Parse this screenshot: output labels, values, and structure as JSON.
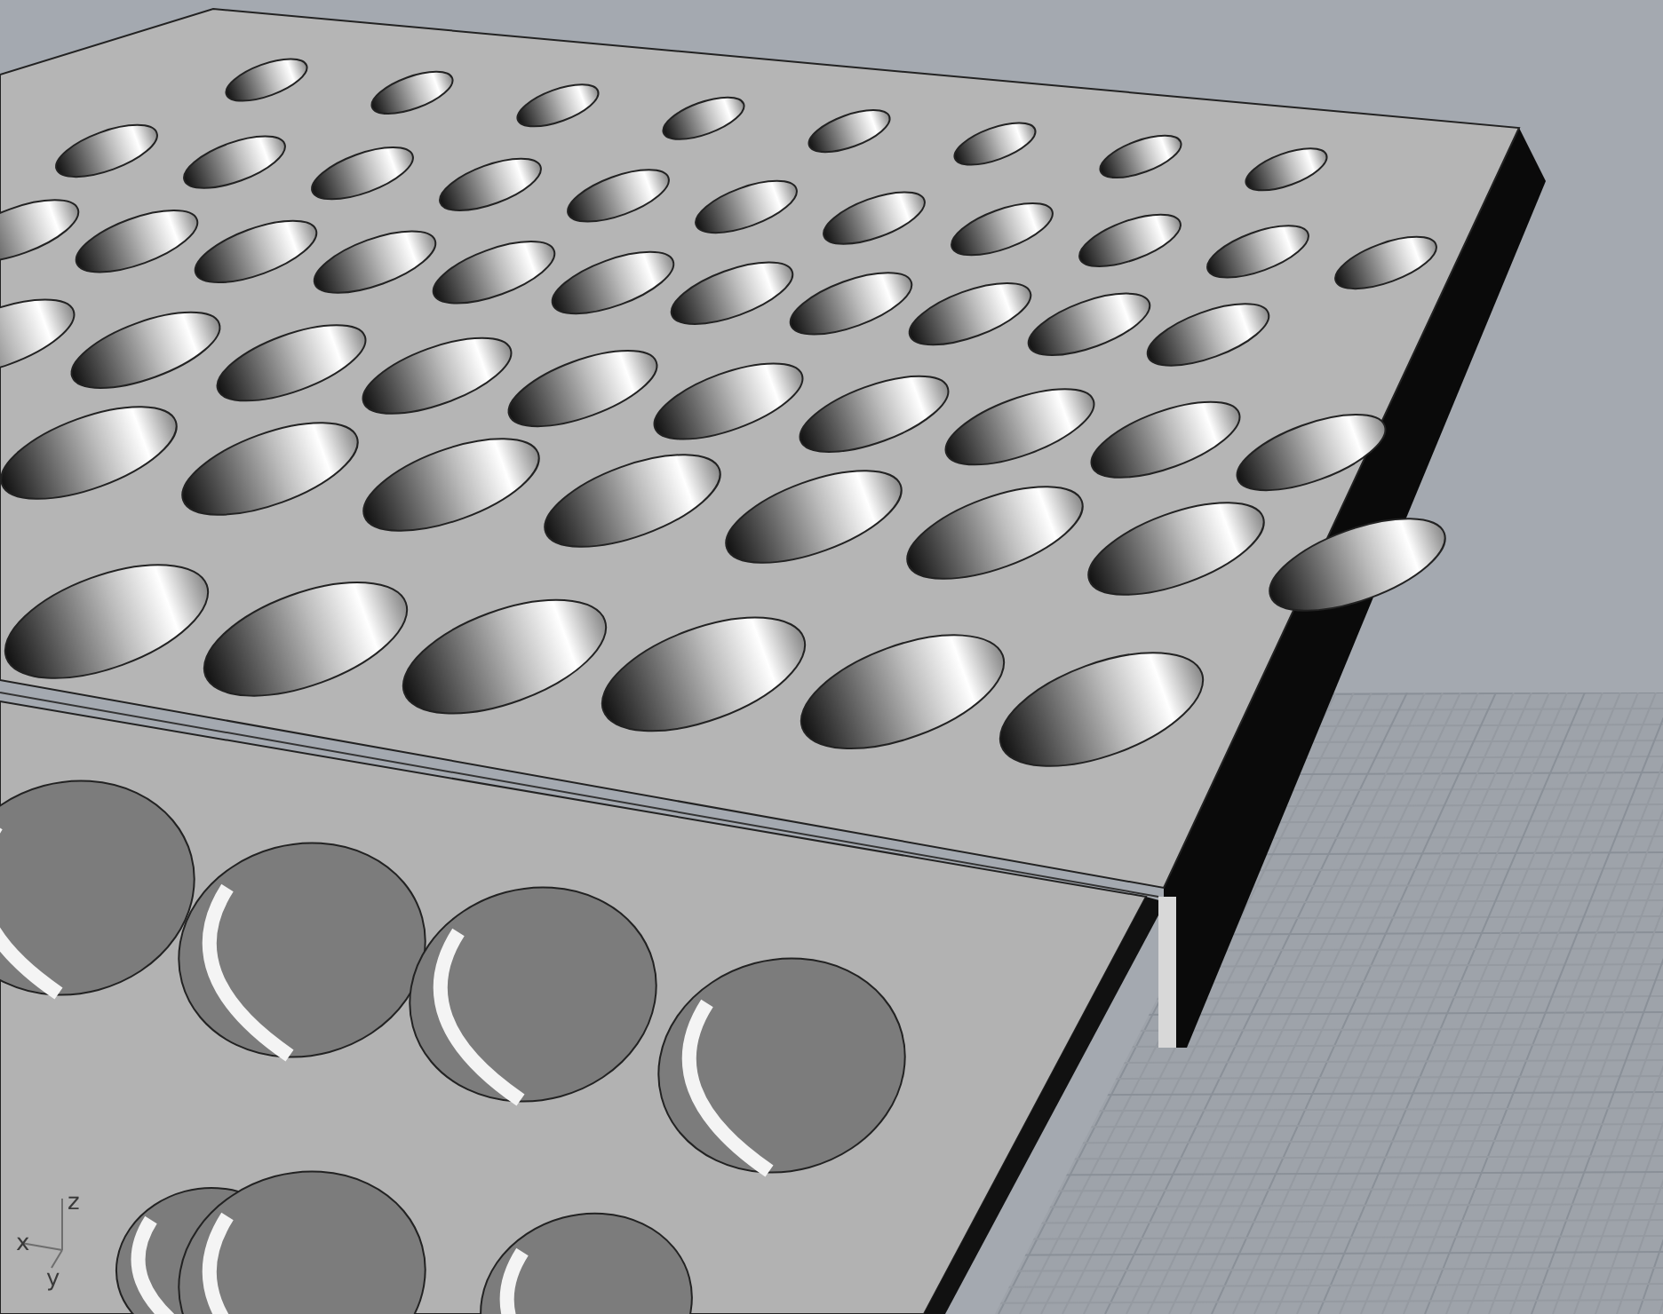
{
  "viewport": {
    "axes": [
      {
        "label": "x"
      },
      {
        "label": "y"
      },
      {
        "label": "z"
      }
    ]
  }
}
